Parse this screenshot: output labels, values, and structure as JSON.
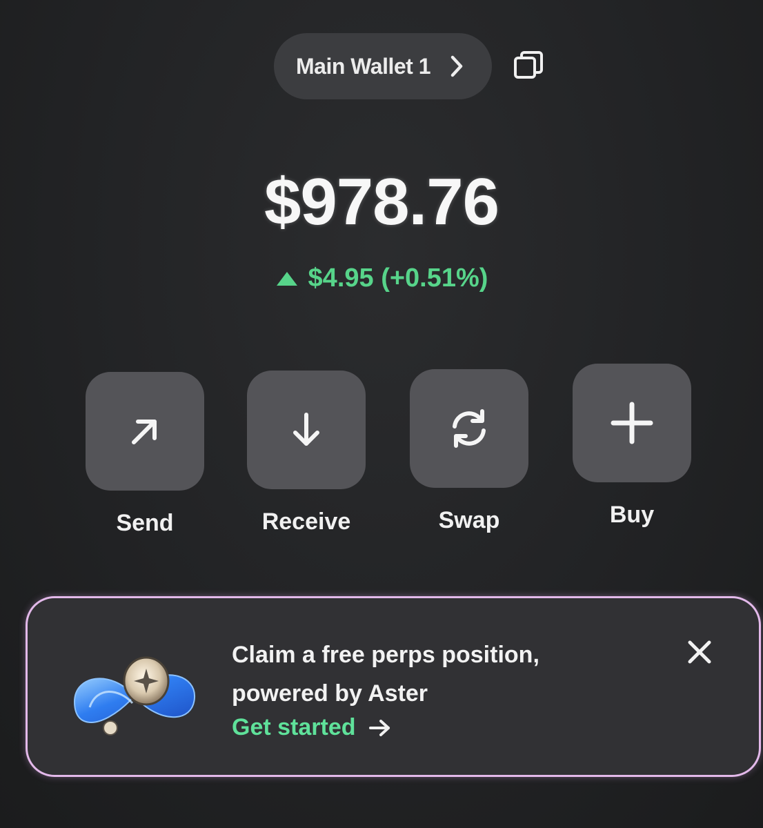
{
  "header": {
    "wallet_name": "Main Wallet 1",
    "chevron_icon": "chevron-right-icon",
    "copy_icon": "copy-icon"
  },
  "balance": {
    "amount": "$978.76",
    "change_text": "$4.95 (+0.51%)",
    "change_direction": "up",
    "change_color": "#57d48a"
  },
  "actions": [
    {
      "label": "Send",
      "icon": "arrow-up-right-icon"
    },
    {
      "label": "Receive",
      "icon": "arrow-down-icon"
    },
    {
      "label": "Swap",
      "icon": "swap-icon"
    },
    {
      "label": "Buy",
      "icon": "plus-icon"
    }
  ],
  "promo": {
    "title_line1": "Claim a free perps position,",
    "title_line2": "powered by Aster",
    "cta": "Get started",
    "cta_color": "#5fe19a",
    "border_color": "#e3b9ea",
    "logo": "aster-logo",
    "close_icon": "close-icon"
  }
}
